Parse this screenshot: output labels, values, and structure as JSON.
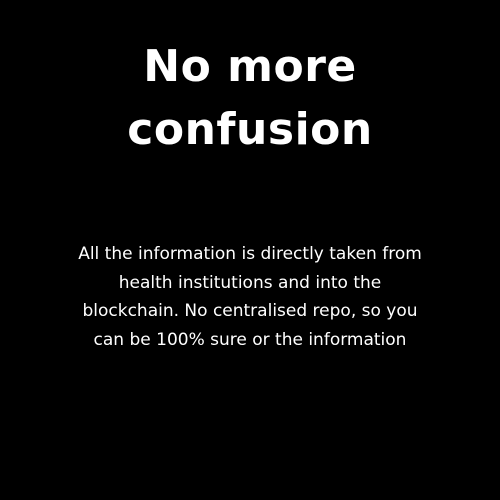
{
  "slide": {
    "background_color": "#000000",
    "text_color": "#ffffff",
    "title_lines": [
      "No more",
      "confusion"
    ],
    "body_lines": [
      "All the information is directly taken from",
      "health institutions and into the",
      "blockchain. No centralised repo, so you",
      "can be 100% sure or the information"
    ]
  }
}
